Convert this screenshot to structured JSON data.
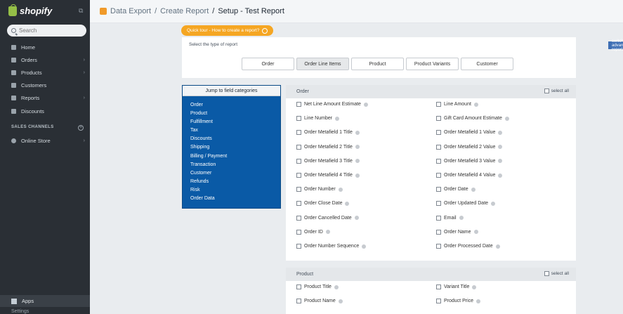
{
  "brand": {
    "name": "shopify"
  },
  "search": {
    "placeholder": "Search"
  },
  "nav": [
    {
      "label": "Home",
      "icon": "home-icon",
      "chevron": false
    },
    {
      "label": "Orders",
      "icon": "orders-icon",
      "chevron": true
    },
    {
      "label": "Products",
      "icon": "tag-icon",
      "chevron": true
    },
    {
      "label": "Customers",
      "icon": "customers-icon",
      "chevron": false
    },
    {
      "label": "Reports",
      "icon": "reports-icon",
      "chevron": true
    },
    {
      "label": "Discounts",
      "icon": "discount-icon",
      "chevron": false
    }
  ],
  "sales_channels": {
    "label": "SALES CHANNELS",
    "items": [
      {
        "label": "Online Store",
        "icon": "online-store-icon"
      }
    ]
  },
  "apps_label": "Apps",
  "settings_label": "Settings",
  "breadcrumb": {
    "app": "Data Export",
    "parent": "Create Report",
    "current": "Setup - Test Report"
  },
  "quick_tour": "Quick tour - How to create a report?",
  "advanced_button": "switch to advanced report",
  "report_type": {
    "title": "Select the type of report",
    "options": [
      "Order",
      "Order Line Items",
      "Product",
      "Product Variants",
      "Customer"
    ],
    "selected": "Order Line Items"
  },
  "jump": {
    "title": "Jump to field categories",
    "items": [
      "Order",
      "Product",
      "Fulfillment",
      "Tax",
      "Discounts",
      "Shipping",
      "Billing / Payment",
      "Transaction",
      "Customer",
      "Refunds",
      "Risk",
      "Order Data"
    ]
  },
  "order_section": {
    "title": "Order",
    "select_all": "select all",
    "fields": [
      "Net Line Amount Estimate",
      "Line Amount",
      "Line Number",
      "Gift Card Amount Estimate",
      "Order Metafield 1 Title",
      "Order Metafield 1 Value",
      "Order Metafield 2 Title",
      "Order Metafield 2 Value",
      "Order Metafield 3 Title",
      "Order Metafield 3 Value",
      "Order Metafield 4 Title",
      "Order Metafield 4 Value",
      "Order Number",
      "Order Date",
      "Order Close Date",
      "Order Updated Date",
      "Order Cancelled Date",
      "Email",
      "Order ID",
      "Order Name",
      "Order Number Sequence",
      "Order Processed Date"
    ]
  },
  "product_section": {
    "title": "Product",
    "select_all": "select all",
    "fields": [
      "Product Title",
      "Variant Title",
      "Product Name",
      "Product Price"
    ]
  }
}
